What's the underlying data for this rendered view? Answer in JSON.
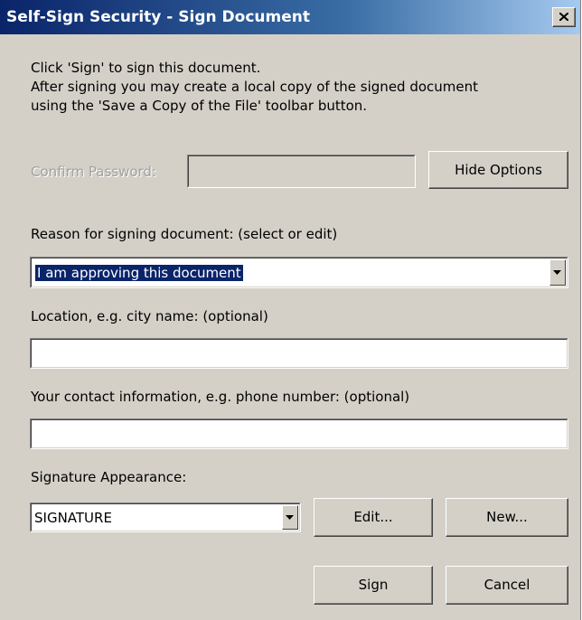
{
  "window": {
    "title": "Self-Sign Security - Sign Document",
    "close_glyph": "close-icon"
  },
  "intro": {
    "line1": "Click 'Sign' to sign this document.",
    "line2": "After signing you may create a local copy of the signed document",
    "line3": "using the 'Save a Copy of the File' toolbar button."
  },
  "password": {
    "label": "Confirm Password:",
    "value": "",
    "enabled": false
  },
  "hide_options_label": "Hide Options",
  "reason": {
    "label": "Reason for signing document: (select or edit)",
    "value": "I am approving this document"
  },
  "location": {
    "label": "Location, e.g. city name: (optional)",
    "value": ""
  },
  "contact": {
    "label": "Your contact information, e.g. phone number: (optional)",
    "value": ""
  },
  "appearance": {
    "label": "Signature Appearance:",
    "value": "SIGNATURE",
    "edit_label": "Edit...",
    "new_label": "New..."
  },
  "actions": {
    "sign_label": "Sign",
    "cancel_label": "Cancel"
  },
  "colors": {
    "dialog_face": "#d4d0c8",
    "title_start": "#0a246a",
    "title_end": "#a6caf0",
    "selection": "#0a246a"
  }
}
